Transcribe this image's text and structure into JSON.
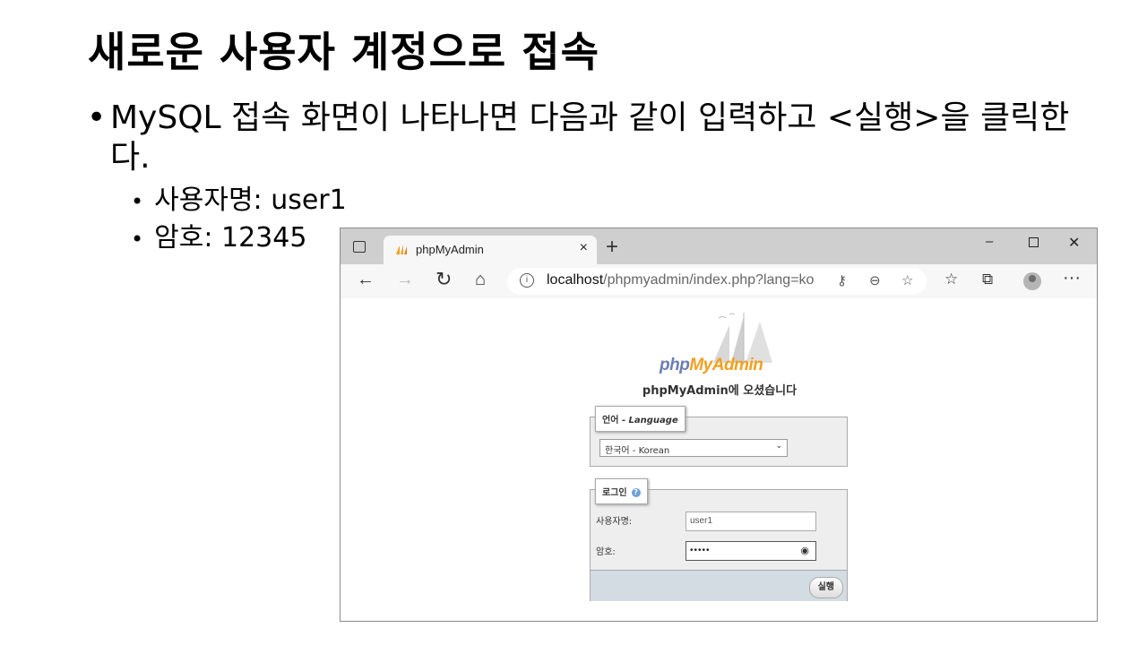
{
  "slide": {
    "title": "새로운 사용자 계정으로 접속",
    "bullet_main": "MySQL 접속 화면이 나타나면 다음과 같이 입력하고 <실행>을 클릭한다.",
    "sub_bullets": [
      "사용자명: user1",
      "암호: 12345"
    ]
  },
  "browser": {
    "tab_title": "phpMyAdmin",
    "tab_close": "×",
    "new_tab": "+",
    "window": {
      "minimize": "–",
      "close": "✕"
    },
    "address": {
      "host": "localhost",
      "path": "/phpmyadmin/index.php?lang=ko"
    }
  },
  "page": {
    "logo_php": "php",
    "logo_myadmin": "MyAdmin",
    "welcome": "phpMyAdmin에 오셨습니다",
    "language": {
      "legend_ko": "언어 - ",
      "legend_en": "Language",
      "selected": "한국어 - Korean"
    },
    "login": {
      "legend": "로그인",
      "username_label": "사용자명:",
      "username_value": "user1",
      "password_label": "암호:",
      "password_value": "•••••",
      "submit": "실행"
    }
  },
  "icons": [
    "tab-actions-icon",
    "pma-favicon",
    "back-arrow-icon",
    "forward-arrow-icon",
    "reload-icon",
    "home-icon",
    "info-icon",
    "key-icon",
    "zoom-out-icon",
    "add-favorite-icon",
    "favorites-icon",
    "collections-icon",
    "profile-icon",
    "more-icon",
    "help-icon",
    "eye-icon",
    "chevron-down-icon"
  ]
}
